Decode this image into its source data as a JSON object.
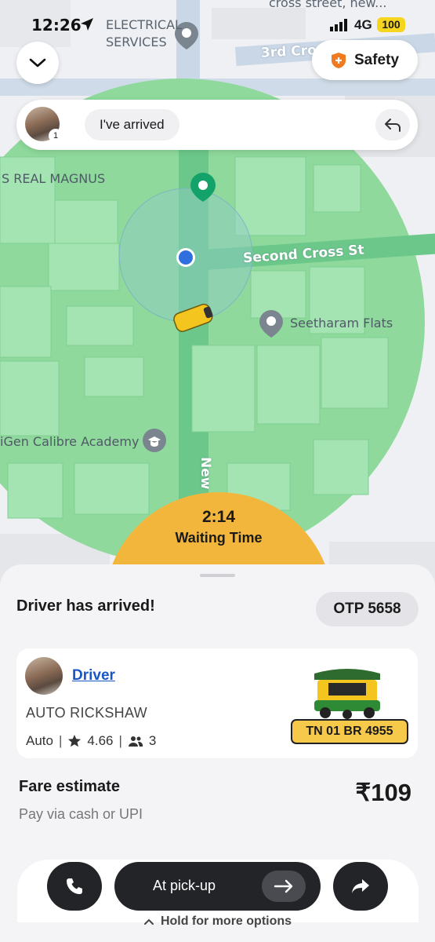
{
  "status_bar": {
    "time": "12:26",
    "network": "4G",
    "battery": "100"
  },
  "map": {
    "labels": {
      "electrical_line1": "ELECTRICAL",
      "electrical_line2": "SERVICES",
      "cross_street_top": "cross street, new...",
      "third_cross": "3rd Cro",
      "real_magnus": "S REAL MAGNUS",
      "second_cross": "Second Cross St",
      "seetharam": "Seetharam Flats",
      "calibre": "iGen Calibre Academy",
      "new_road": "New"
    }
  },
  "safety": {
    "label": "Safety"
  },
  "arrival": {
    "message": "I've arrived",
    "passenger_count": "1"
  },
  "waiting": {
    "time": "2:14",
    "label": "Waiting Time"
  },
  "sheet": {
    "title": "Driver has arrived!",
    "otp": "OTP 5658",
    "driver": {
      "name": "Driver",
      "vehicle_type": "AUTO RICKSHAW",
      "category": "Auto",
      "rating": "4.66",
      "seats": "3",
      "plate": "TN 01 BR 4955"
    },
    "fare": {
      "title": "Fare estimate",
      "subtitle": "Pay via cash or UPI",
      "amount": "₹109"
    },
    "actions": {
      "pickup_label": "At pick-up",
      "hold_hint": "Hold for more options"
    }
  },
  "colors": {
    "accent_orange": "#f3b63c",
    "radius_green": "#8ed99b",
    "dark_button": "#232428",
    "link_blue": "#1a56c4"
  }
}
